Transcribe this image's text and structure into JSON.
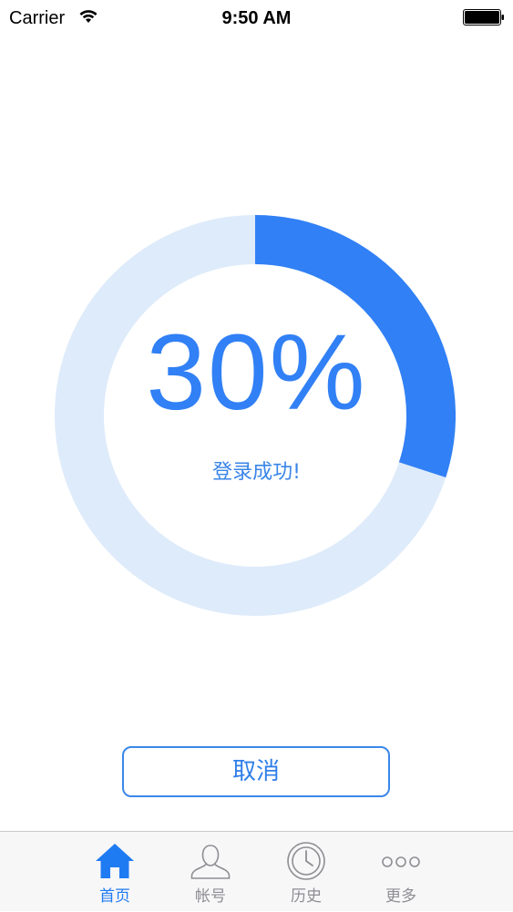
{
  "status_bar": {
    "carrier": "Carrier",
    "time": "9:50 AM"
  },
  "progress": {
    "percent_text": "30%",
    "fraction": 0.3,
    "message": "登录成功!",
    "track_color": "#deebfa",
    "fill_color": "#3180f5"
  },
  "actions": {
    "cancel_label": "取消"
  },
  "tab_bar": {
    "active_color": "#1f7bf2",
    "inactive_color": "#8e8e93",
    "tabs": [
      {
        "label": "首页",
        "icon": "home-icon",
        "active": true
      },
      {
        "label": "帐号",
        "icon": "person-icon",
        "active": false
      },
      {
        "label": "历史",
        "icon": "clock-icon",
        "active": false
      },
      {
        "label": "更多",
        "icon": "more-dots-icon",
        "active": false
      }
    ]
  }
}
